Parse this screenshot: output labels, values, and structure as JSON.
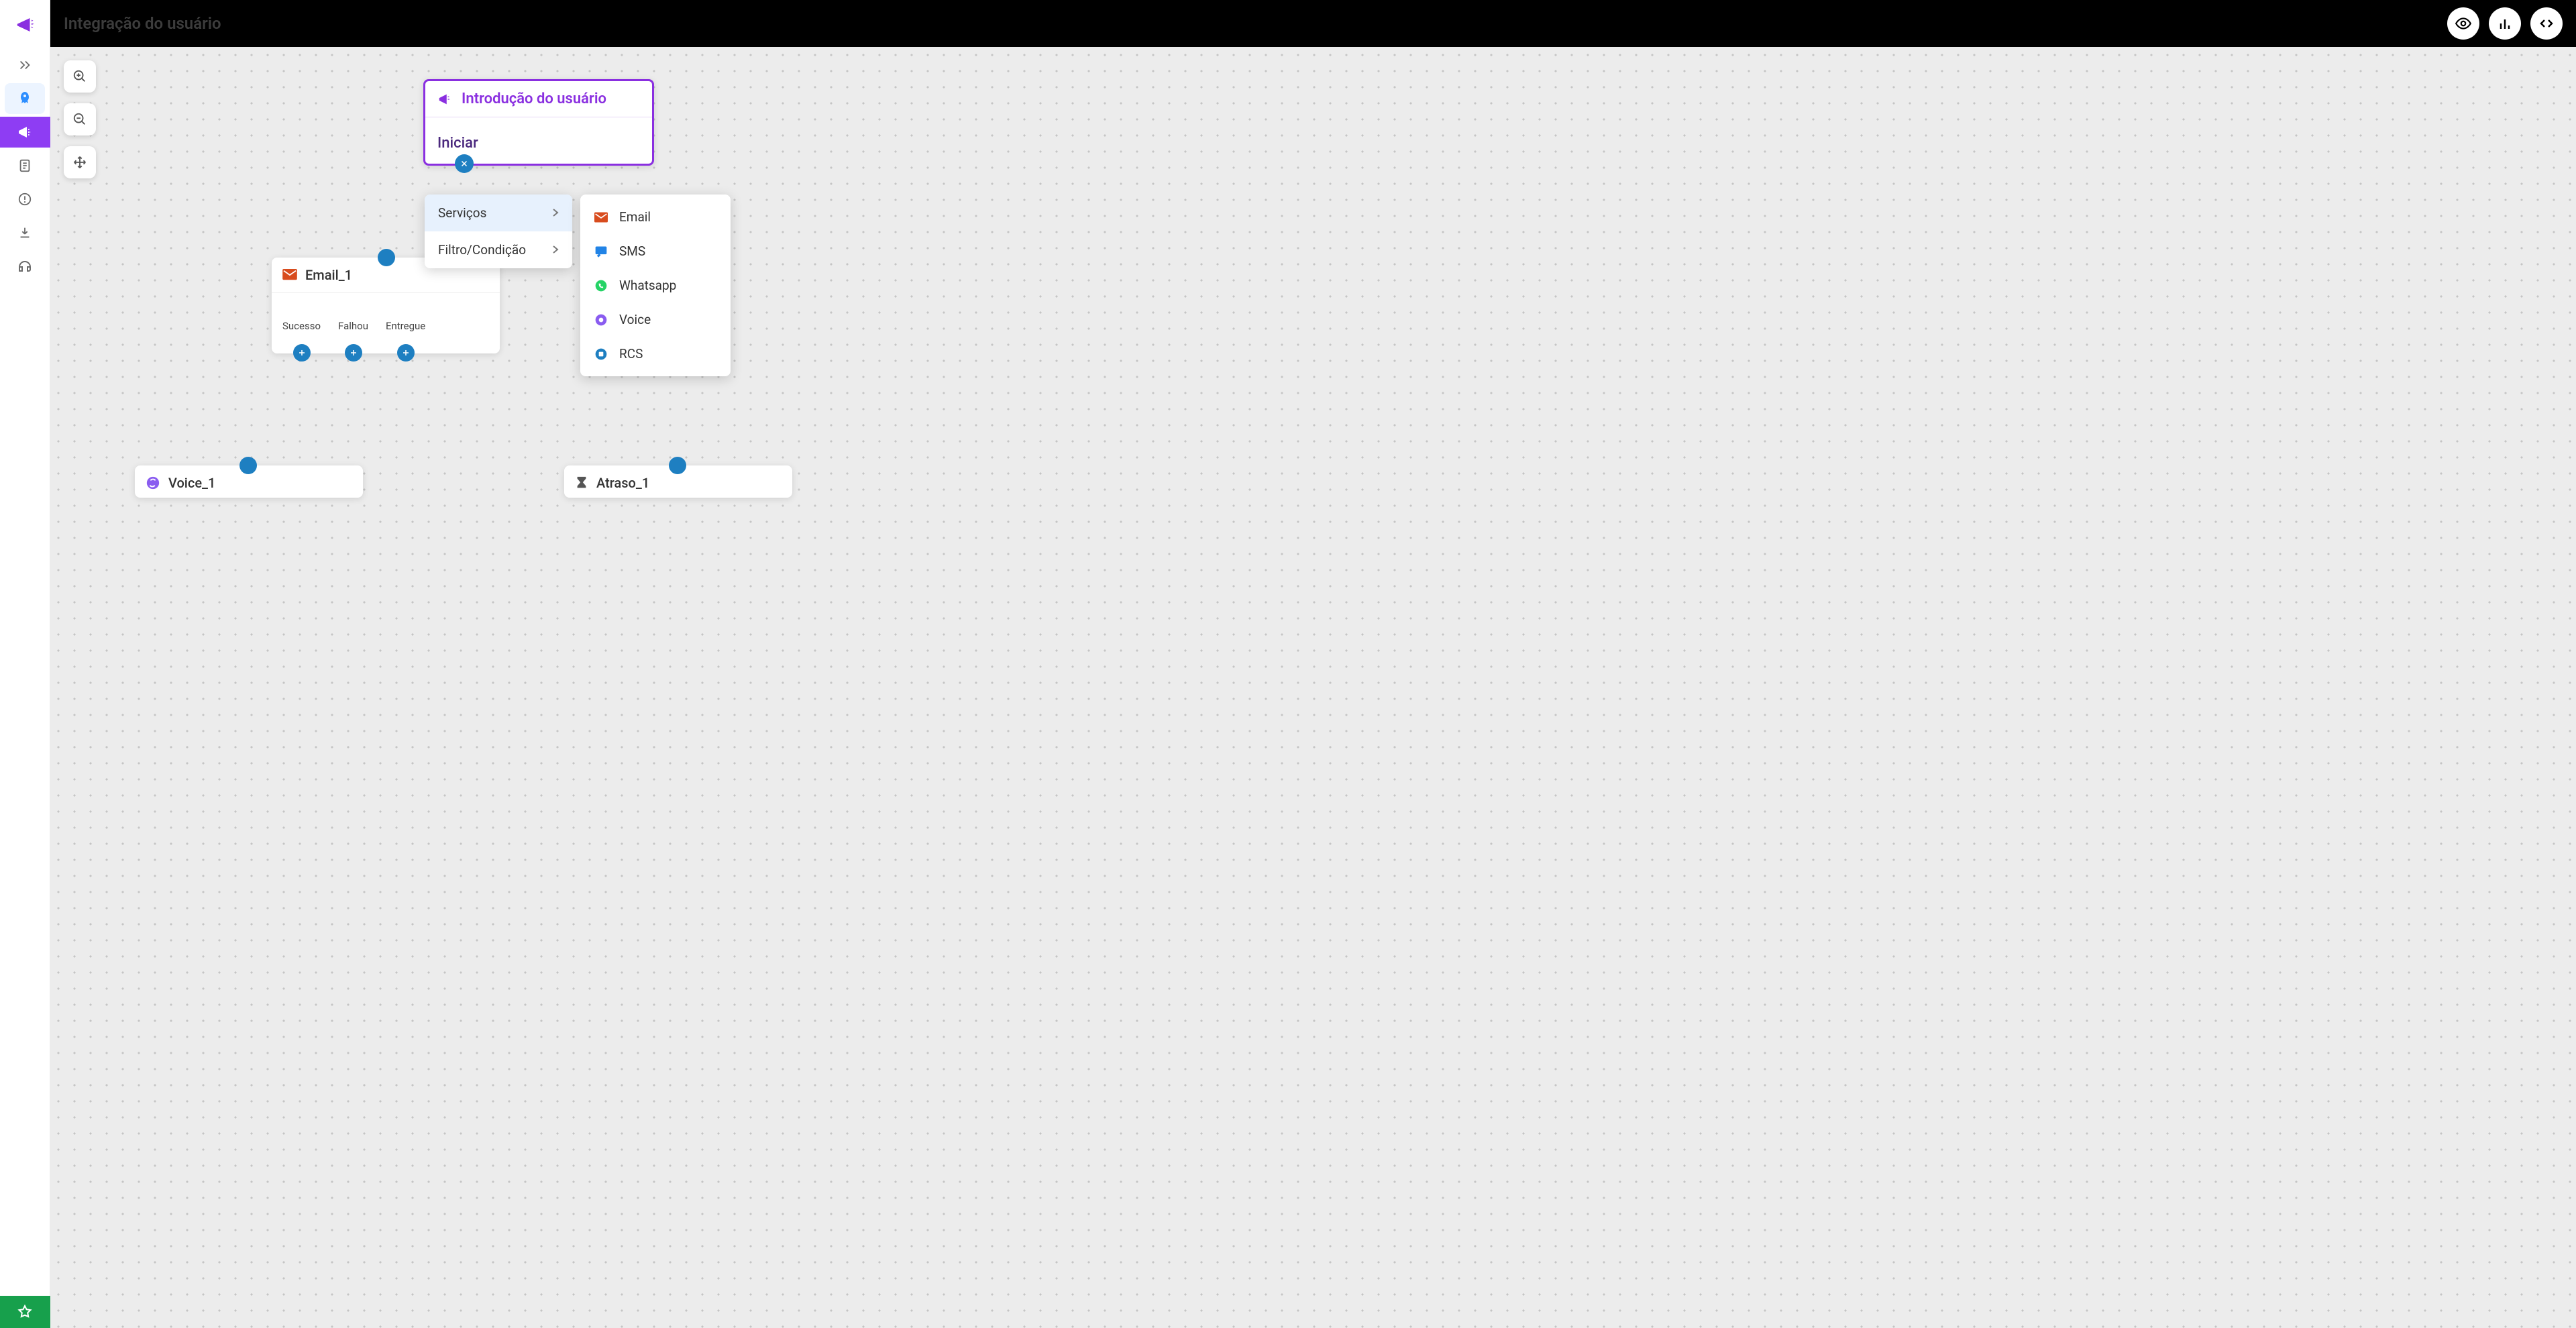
{
  "header": {
    "title": "Integração do usuário"
  },
  "sidebar": {
    "items": [
      "expand",
      "rocket",
      "megaphone",
      "doc",
      "alert",
      "download",
      "headset"
    ]
  },
  "colors": {
    "brand": "#8a2fe0",
    "accent": "#1e7fc1",
    "green": "#17a04c"
  },
  "intro_node": {
    "title": "Introdução do usuário",
    "action": "Iniciar"
  },
  "email_node": {
    "title": "Email_1",
    "outcomes": [
      "Sucesso",
      "Falhou",
      "Entregue"
    ]
  },
  "voice_node": {
    "title": "Voice_1"
  },
  "delay_node": {
    "title": "Atraso_1"
  },
  "menu": {
    "items": [
      {
        "label": "Serviços",
        "selected": true
      },
      {
        "label": "Filtro/Condição",
        "selected": false
      }
    ]
  },
  "submenu": {
    "items": [
      {
        "icon": "email",
        "label": "Email"
      },
      {
        "icon": "sms",
        "label": "SMS"
      },
      {
        "icon": "whatsapp",
        "label": "Whatsapp"
      },
      {
        "icon": "voice",
        "label": "Voice"
      },
      {
        "icon": "rcs",
        "label": "RCS"
      }
    ]
  }
}
